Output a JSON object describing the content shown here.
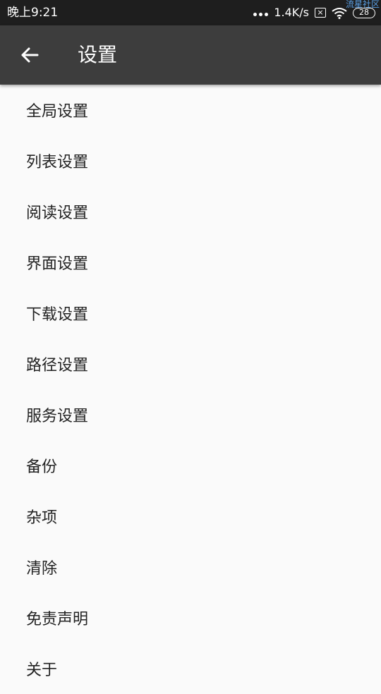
{
  "status_bar": {
    "time": "晚上9:21",
    "network_speed": "1.4K/s",
    "battery_level": "28",
    "watermark": "流星社区",
    "icons": [
      "more-dots-icon",
      "no-sim-icon",
      "wifi-icon",
      "battery-icon"
    ]
  },
  "app_bar": {
    "title": "设置",
    "back_icon": "arrow-left-icon",
    "background_color": "#3d3d3d"
  },
  "settings": {
    "items": [
      {
        "label": "全局设置"
      },
      {
        "label": "列表设置"
      },
      {
        "label": "阅读设置"
      },
      {
        "label": "界面设置"
      },
      {
        "label": "下载设置"
      },
      {
        "label": "路径设置"
      },
      {
        "label": "服务设置"
      },
      {
        "label": "备份"
      },
      {
        "label": "杂项"
      },
      {
        "label": "清除"
      },
      {
        "label": "免责声明"
      },
      {
        "label": "关于"
      }
    ]
  }
}
